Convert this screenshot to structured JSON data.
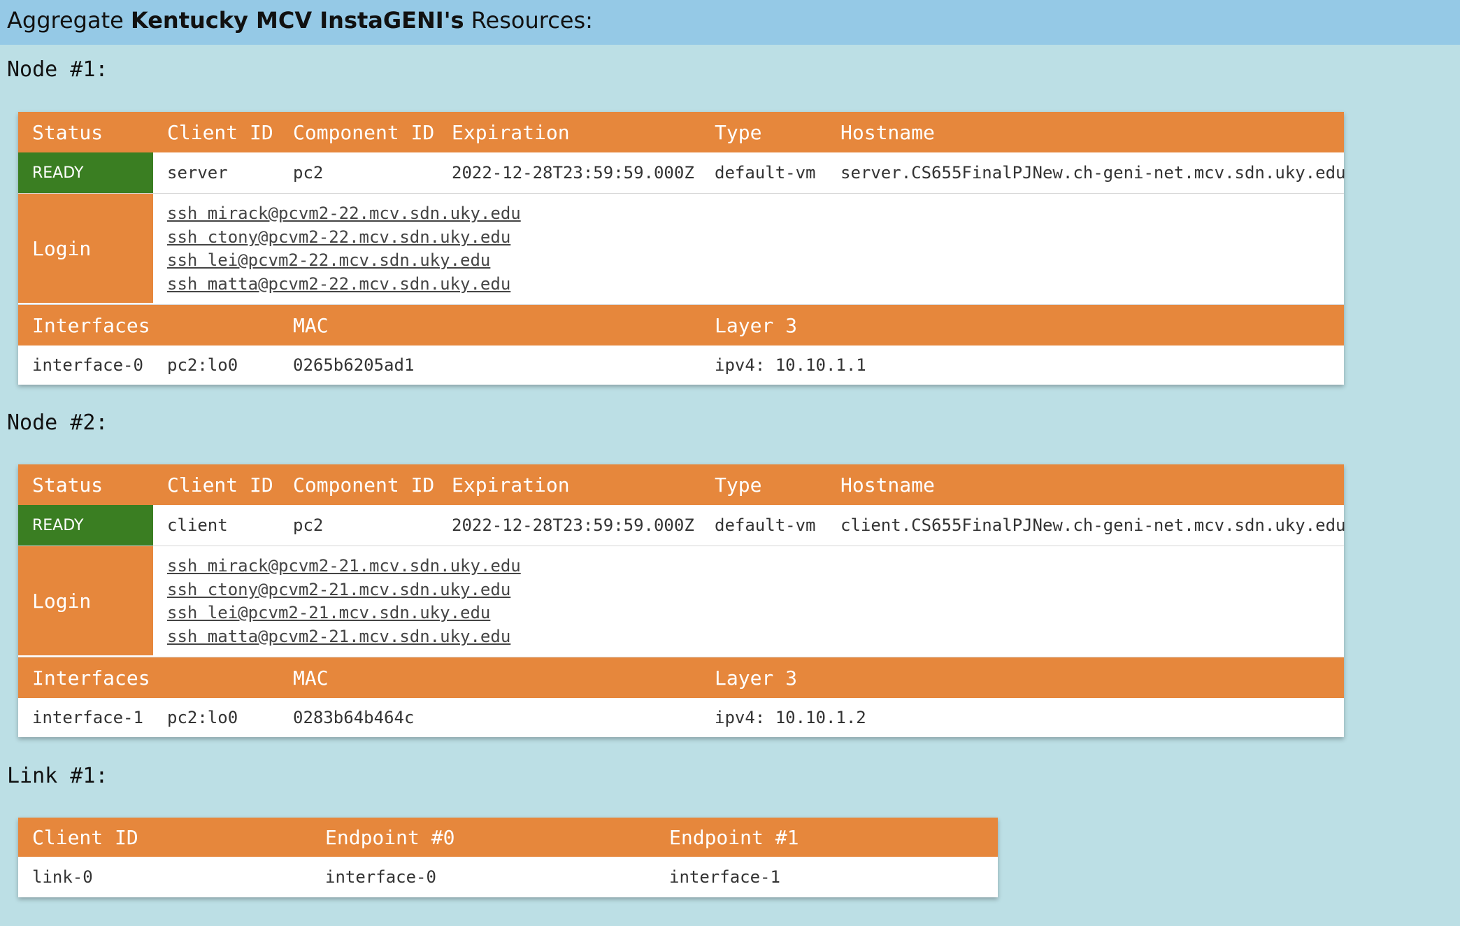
{
  "header": {
    "prefix": "Aggregate ",
    "aggregate_name": "Kentucky MCV InstaGENI's",
    "suffix": " Resources:"
  },
  "nodes": [
    {
      "title": "Node #1:",
      "columns": {
        "status": "Status",
        "client_id": "Client ID",
        "component_id": "Component ID",
        "expiration": "Expiration",
        "type": "Type",
        "hostname": "Hostname"
      },
      "status": "READY",
      "client_id": "server",
      "component_id": "pc2",
      "expiration": "2022-12-28T23:59:59.000Z",
      "type": "default-vm",
      "hostname": "server.CS655FinalPJNew.ch-geni-net.mcv.sdn.uky.edu",
      "login_label": "Login",
      "logins": [
        "ssh mirack@pcvm2-22.mcv.sdn.uky.edu",
        "ssh ctony@pcvm2-22.mcv.sdn.uky.edu",
        "ssh lei@pcvm2-22.mcv.sdn.uky.edu",
        "ssh matta@pcvm2-22.mcv.sdn.uky.edu"
      ],
      "iface_columns": {
        "interfaces": "Interfaces",
        "mac": "MAC",
        "layer3": "Layer 3"
      },
      "iface": {
        "name": "interface-0",
        "id": "pc2:lo0",
        "mac": "0265b6205ad1",
        "layer3": "ipv4: 10.10.1.1"
      }
    },
    {
      "title": "Node #2:",
      "columns": {
        "status": "Status",
        "client_id": "Client ID",
        "component_id": "Component ID",
        "expiration": "Expiration",
        "type": "Type",
        "hostname": "Hostname"
      },
      "status": "READY",
      "client_id": "client",
      "component_id": "pc2",
      "expiration": "2022-12-28T23:59:59.000Z",
      "type": "default-vm",
      "hostname": "client.CS655FinalPJNew.ch-geni-net.mcv.sdn.uky.edu",
      "login_label": "Login",
      "logins": [
        "ssh mirack@pcvm2-21.mcv.sdn.uky.edu",
        "ssh ctony@pcvm2-21.mcv.sdn.uky.edu",
        "ssh lei@pcvm2-21.mcv.sdn.uky.edu",
        "ssh matta@pcvm2-21.mcv.sdn.uky.edu"
      ],
      "iface_columns": {
        "interfaces": "Interfaces",
        "mac": "MAC",
        "layer3": "Layer 3"
      },
      "iface": {
        "name": "interface-1",
        "id": "pc2:lo0",
        "mac": "0283b64b464c",
        "layer3": "ipv4: 10.10.1.2"
      }
    }
  ],
  "link": {
    "title": "Link #1:",
    "columns": {
      "client_id": "Client ID",
      "endpoint0": "Endpoint #0",
      "endpoint1": "Endpoint #1"
    },
    "client_id": "link-0",
    "endpoint0": "interface-0",
    "endpoint1": "interface-1"
  },
  "colors": {
    "header_bg": "#95c9e6",
    "page_bg": "#bcdfe5",
    "table_header": "#e6873c",
    "ready": "#3a7e22"
  }
}
